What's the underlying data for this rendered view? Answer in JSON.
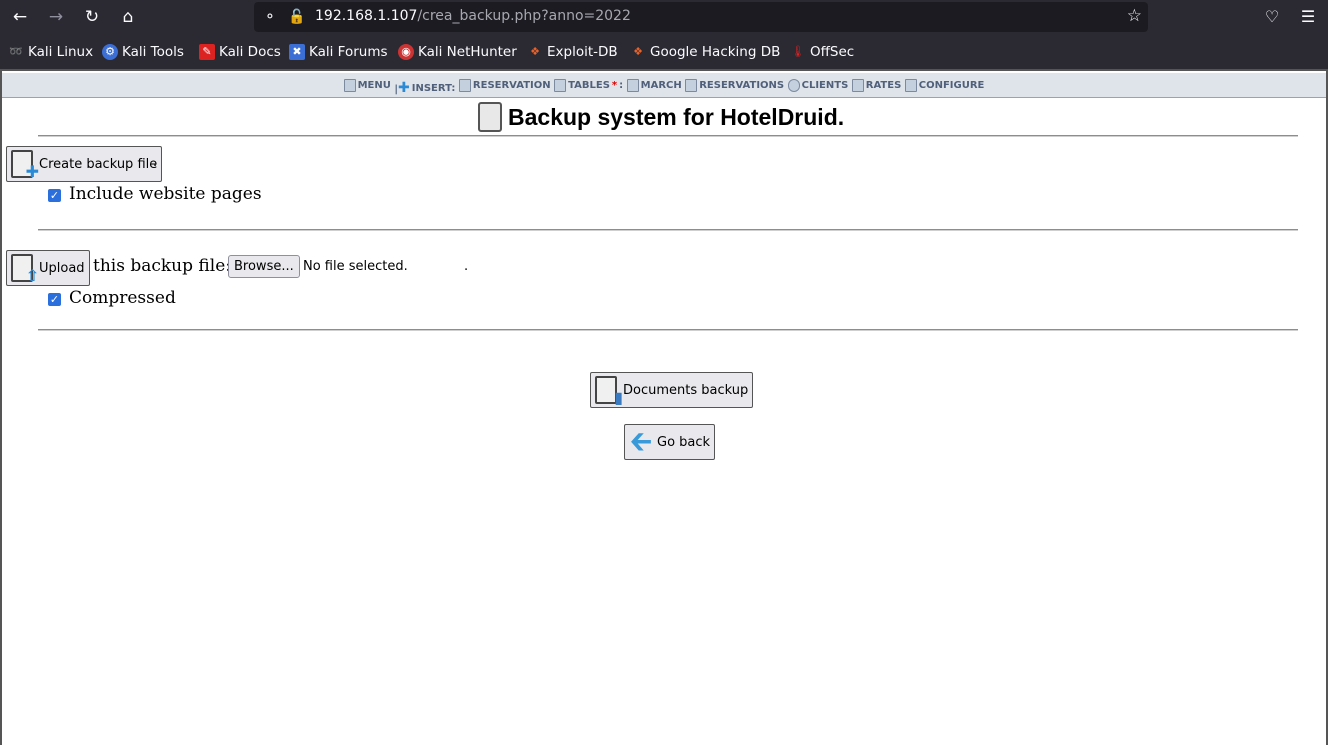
{
  "browser": {
    "url_host": "192.168.1.107",
    "url_path": "/crea_backup.php?anno=2022",
    "bookmarks": [
      {
        "label": "Kali Linux",
        "icon": "kali-dragon-icon"
      },
      {
        "label": "Kali Tools",
        "icon": "kali-tools-icon"
      },
      {
        "label": "Kali Docs",
        "icon": "kali-docs-icon"
      },
      {
        "label": "Kali Forums",
        "icon": "kali-forums-icon"
      },
      {
        "label": "Kali NetHunter",
        "icon": "kali-nethunter-icon"
      },
      {
        "label": "Exploit-DB",
        "icon": "exploit-db-icon"
      },
      {
        "label": "Google Hacking DB",
        "icon": "ghdb-icon"
      },
      {
        "label": "OffSec",
        "icon": "offsec-icon"
      }
    ]
  },
  "menu": {
    "menu": "MENU",
    "insert": "INSERT:",
    "reservation": "RESERVATION",
    "tables": "TABLES",
    "march": "MARCH",
    "reservations": "RESERVATIONS",
    "clients": "CLIENTS",
    "rates": "RATES",
    "configure": "CONFIGURE"
  },
  "page": {
    "title": "Backup system for HotelDruid.",
    "create_backup_label": "Create backup file",
    "include_website_label": "Include website pages",
    "include_website_checked": true,
    "upload_label": "Upload",
    "upload_text": "this backup file:",
    "browse_label": "Browse...",
    "no_file_text": "No file selected.",
    "compressed_label": "Compressed",
    "compressed_checked": true,
    "documents_backup_label": "Documents backup",
    "go_back_label": "Go back"
  }
}
